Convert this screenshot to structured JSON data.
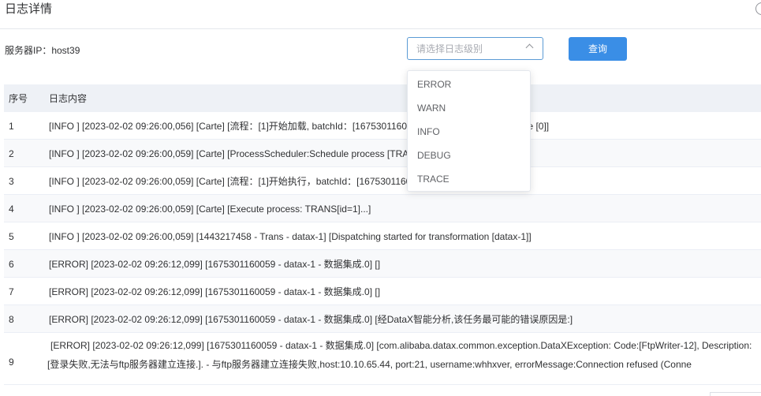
{
  "header": {
    "title": "日志详情"
  },
  "filters": {
    "server_ip_label": "服务器IP：host39",
    "level_select_placeholder": "请选择日志级别",
    "query_button": "查询"
  },
  "table": {
    "columns": [
      "序号",
      "日志内容"
    ],
    "rows": [
      {
        "no": "1",
        "content": "[INFO ] [2023-02-02 09:26:00,056] [Carte] [流程：[1]开始加载, batchId：[1675301160059], jobId：[datax-1], jobtype [0]]"
      },
      {
        "no": "2",
        "content": "[INFO ] [2023-02-02 09:26:00,059] [Carte] [ProcessScheduler:Schedule process [TRANS[id=1]] ... succeed.]"
      },
      {
        "no": "3",
        "content": "[INFO ] [2023-02-02 09:26:00,059] [Carte] [流程：[1]开始执行，batchId：[1675301160059]]"
      },
      {
        "no": "4",
        "content": "[INFO ] [2023-02-02 09:26:00,059] [Carte] [Execute process: TRANS[id=1]...]"
      },
      {
        "no": "5",
        "content": "[INFO ] [2023-02-02 09:26:00,059] [1443217458 - Trans - datax-1] [Dispatching started for transformation [datax-1]]"
      },
      {
        "no": "6",
        "content": "[ERROR] [2023-02-02 09:26:12,099] [1675301160059 - datax-1 - 数据集成.0] []"
      },
      {
        "no": "7",
        "content": "[ERROR] [2023-02-02 09:26:12,099] [1675301160059 - datax-1 - 数据集成.0] []"
      },
      {
        "no": "8",
        "content": "[ERROR] [2023-02-02 09:26:12,099] [1675301160059 - datax-1 - 数据集成.0] [经DataX智能分析,该任务最可能的错误原因是:]"
      },
      {
        "no": "9",
        "content": "[ERROR] [2023-02-02 09:26:12,099] [1675301160059 - datax-1 - 数据集成.0] [com.alibaba.datax.common.exception.DataXException: Code:[FtpWriter-12], Description:[登录失败,无法与ftp服务器建立连接.]. - 与ftp服务器建立连接失败,host:10.10.65.44, port:21, username:whhxver, errorMessage:Connection refused (Conne"
      }
    ]
  },
  "dropdown": {
    "options": [
      "ERROR",
      "WARN",
      "INFO",
      "DEBUG",
      "TRACE"
    ]
  }
}
